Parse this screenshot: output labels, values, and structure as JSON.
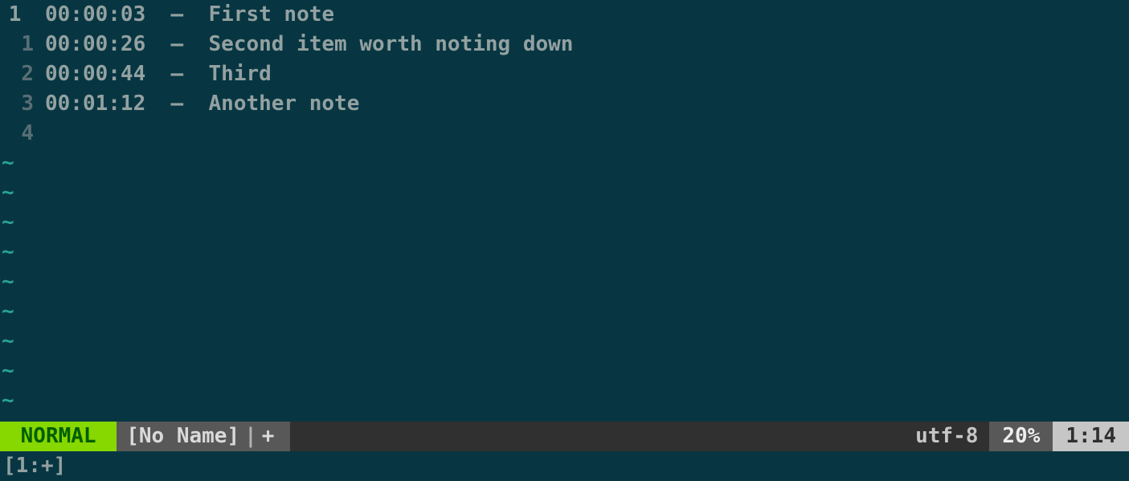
{
  "editor": {
    "current_line_gutter": "1 ",
    "lines": [
      {
        "gutter": "1 ",
        "current": true,
        "timestamp": "00:00:03",
        "sep": "  –  ",
        "text": "First note"
      },
      {
        "gutter": "1",
        "current": false,
        "timestamp": "00:00:26",
        "sep": "  –  ",
        "text": "Second item worth noting down"
      },
      {
        "gutter": "2",
        "current": false,
        "timestamp": "00:00:44",
        "sep": "  –  ",
        "text": "Third"
      },
      {
        "gutter": "3",
        "current": false,
        "timestamp": "00:01:12",
        "sep": "  –  ",
        "text": "Another note"
      },
      {
        "gutter": "4",
        "current": false,
        "timestamp": "",
        "sep": "",
        "text": ""
      }
    ],
    "tilde": "~",
    "tilde_count": 9
  },
  "statusline": {
    "mode": " NORMAL ",
    "filename": "[No Name]",
    "pipe": "|",
    "modified": "+",
    "encoding": "utf-8",
    "percent": "20%",
    "position": "1:14"
  },
  "bottom": {
    "text": "[1:+]"
  }
}
